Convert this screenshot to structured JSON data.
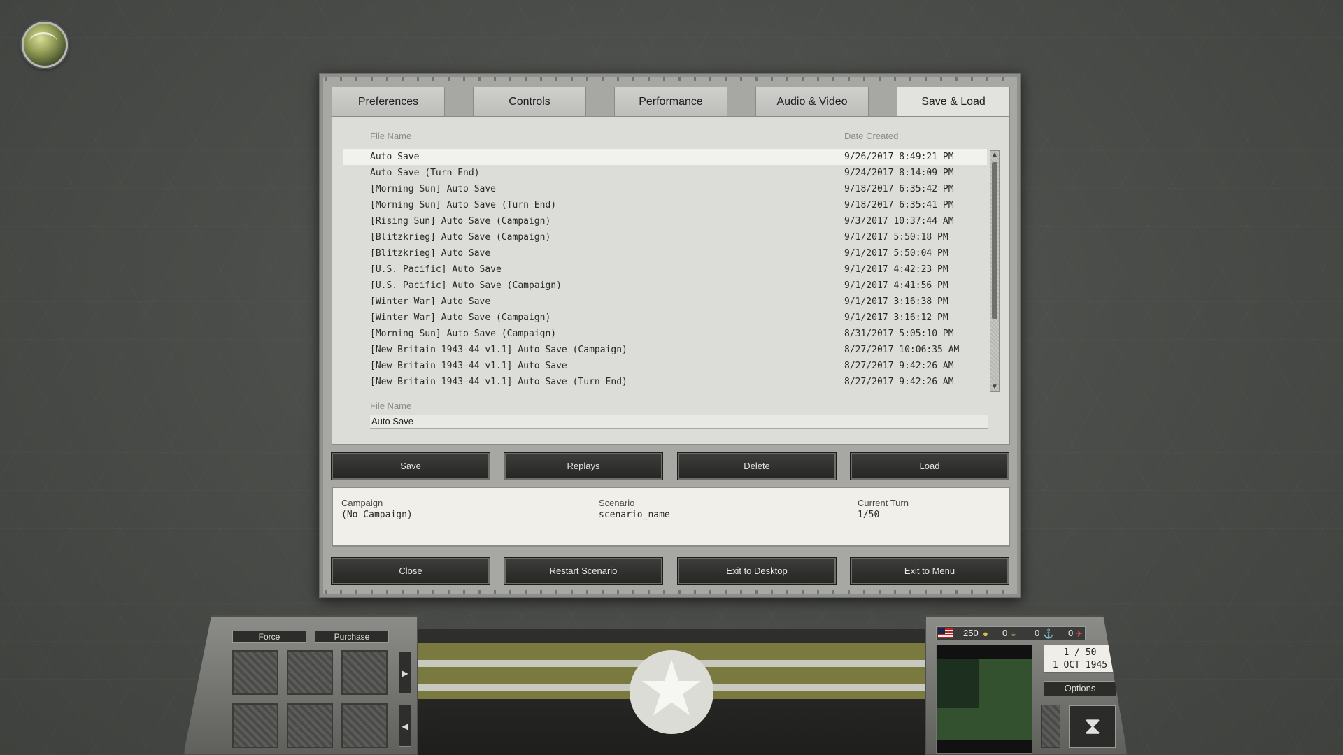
{
  "tabs": [
    {
      "label": "Preferences"
    },
    {
      "label": "Controls"
    },
    {
      "label": "Performance"
    },
    {
      "label": "Audio & Video"
    },
    {
      "label": "Save & Load"
    }
  ],
  "list": {
    "col_filename": "File Name",
    "col_date": "Date Created",
    "rows": [
      {
        "name": "Auto Save",
        "date": "9/26/2017 8:49:21 PM"
      },
      {
        "name": "Auto Save (Turn End)",
        "date": "9/24/2017 8:14:09 PM"
      },
      {
        "name": "[Morning Sun] Auto Save",
        "date": "9/18/2017 6:35:42 PM"
      },
      {
        "name": "[Morning Sun] Auto Save (Turn End)",
        "date": "9/18/2017 6:35:41 PM"
      },
      {
        "name": "[Rising Sun] Auto Save (Campaign)",
        "date": "9/3/2017 10:37:44 AM"
      },
      {
        "name": "[Blitzkrieg] Auto Save (Campaign)",
        "date": "9/1/2017 5:50:18 PM"
      },
      {
        "name": "[Blitzkrieg] Auto Save",
        "date": "9/1/2017 5:50:04 PM"
      },
      {
        "name": "[U.S. Pacific] Auto Save",
        "date": "9/1/2017 4:42:23 PM"
      },
      {
        "name": "[U.S. Pacific] Auto Save (Campaign)",
        "date": "9/1/2017 4:41:56 PM"
      },
      {
        "name": "[Winter War] Auto Save",
        "date": "9/1/2017 3:16:38 PM"
      },
      {
        "name": "[Winter War] Auto Save (Campaign)",
        "date": "9/1/2017 3:16:12 PM"
      },
      {
        "name": "[Morning Sun] Auto Save (Campaign)",
        "date": "8/31/2017 5:05:10 PM"
      },
      {
        "name": "[New Britain 1943-44 v1.1] Auto Save (Campaign)",
        "date": "8/27/2017 10:06:35 AM"
      },
      {
        "name": "[New Britain 1943-44 v1.1] Auto Save",
        "date": "8/27/2017 9:42:26 AM"
      },
      {
        "name": "[New Britain 1943-44 v1.1] Auto Save (Turn End)",
        "date": "8/27/2017 9:42:26 AM"
      }
    ]
  },
  "filename": {
    "label": "File Name",
    "value": "Auto Save"
  },
  "actions": {
    "save": "Save",
    "replays": "Replays",
    "delete": "Delete",
    "load": "Load"
  },
  "info": {
    "campaign_label": "Campaign",
    "campaign_value": "(No Campaign)",
    "scenario_label": "Scenario",
    "scenario_value": "scenario_name",
    "turn_label": "Current Turn",
    "turn_value": "1/50"
  },
  "footer": {
    "close": "Close",
    "restart": "Restart Scenario",
    "exit_desktop": "Exit to Desktop",
    "exit_menu": "Exit to Menu"
  },
  "hud": {
    "force_tab": "Force",
    "purchase_tab": "Purchase",
    "prestige": "250",
    "res1": "0",
    "res2": "0",
    "res3": "0",
    "turn_line": "1 / 50",
    "date_line": "1 OCT 1945",
    "options": "Options",
    "icons": [
      "globe-icon",
      "flag-icon",
      "coin-icon",
      "helmet-icon",
      "anchor-icon",
      "plane-icon",
      "hourglass-icon",
      "star-emblem"
    ]
  }
}
